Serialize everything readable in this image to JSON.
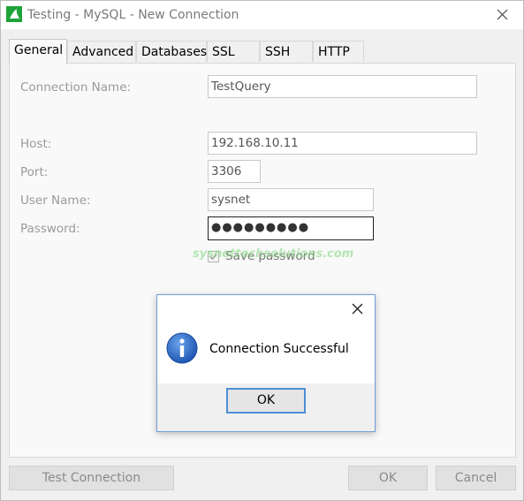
{
  "window": {
    "title": "Testing - MySQL - New Connection"
  },
  "tabs": [
    {
      "label": "General"
    },
    {
      "label": "Advanced"
    },
    {
      "label": "Databases"
    },
    {
      "label": "SSL"
    },
    {
      "label": "SSH"
    },
    {
      "label": "HTTP"
    }
  ],
  "form": {
    "connection_name_label": "Connection Name:",
    "connection_name_value": "TestQuery",
    "host_label": "Host:",
    "host_value": "192.168.10.11",
    "port_label": "Port:",
    "port_value": "3306",
    "user_name_label": "User Name:",
    "user_name_value": "sysnet",
    "password_label": "Password:",
    "password_value": "●●●●●●●●●",
    "save_password_label": "Save password",
    "save_password_checked": true
  },
  "watermark": "sysnettechsolutions.com",
  "buttons": {
    "test_connection": "Test Connection",
    "ok": "OK",
    "cancel": "Cancel"
  },
  "dialog": {
    "message": "Connection Successful",
    "ok": "OK"
  },
  "colors": {
    "dialog_border": "#6d9ed8",
    "info_icon": "#1f57b5",
    "app_icon": "#1ea33a"
  }
}
